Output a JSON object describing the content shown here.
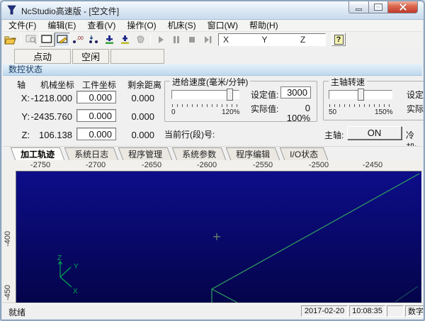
{
  "window": {
    "title": "NcStudio高速版 - [空文件]"
  },
  "menu": {
    "items": [
      "文件(F)",
      "编辑(E)",
      "查看(V)",
      "操作(O)",
      "机床(S)",
      "窗口(W)",
      "帮助(H)"
    ]
  },
  "toolbar": {
    "icons": [
      "open-file",
      "screen-capture",
      "display-window",
      "edit-window",
      "trace-points",
      "simulate-mode",
      "tool-down",
      "tool-calibrate",
      "handwheel",
      "start",
      "pause",
      "stop",
      "single-step",
      "help"
    ],
    "axes_display": "X              Y              Z",
    "help_label": "?"
  },
  "mode_row": {
    "jog": "点动",
    "idle": "空闲"
  },
  "nc_status": {
    "caption": "数控状态",
    "table": {
      "headers": [
        "轴",
        "机械坐标",
        "工件坐标",
        "剩余距离"
      ],
      "rows": [
        {
          "axis": "X:",
          "machine": "-1218.000",
          "work": "0.000",
          "remain": "0.000"
        },
        {
          "axis": "Y:",
          "machine": "-2435.760",
          "work": "0.000",
          "remain": "0.000"
        },
        {
          "axis": "Z:",
          "machine": "106.138",
          "work": "0.000",
          "remain": "0.000"
        }
      ]
    },
    "feed": {
      "title": "进给速度(毫米/分钟)",
      "tick_min": "0",
      "tick_max": "120%",
      "set_label": "设定值:",
      "set_value": "3000",
      "actual_label": "实际值:",
      "actual_value": "0",
      "override": "100%"
    },
    "current_line_label": "当前行(段)号:",
    "spindle": {
      "title": "主轴转速",
      "tick_min": "50",
      "tick_max": "150%",
      "set_label": "设定",
      "actual_label": "实际",
      "spindle_label": "主轴:",
      "power": "ON",
      "coolant_label": "冷却:"
    }
  },
  "view_tabs": [
    {
      "label": "加工轨迹"
    },
    {
      "label": "系统日志"
    },
    {
      "label": "程序管理"
    },
    {
      "label": "系统参数"
    },
    {
      "label": "程序编辑"
    },
    {
      "label": "I/O状态"
    }
  ],
  "canvas": {
    "h_ruler": [
      "-2750",
      "-2700",
      "-2650",
      "-2600",
      "-2550",
      "-2500",
      "-2450"
    ],
    "v_ruler": [
      "-400",
      "-450"
    ],
    "axes": {
      "x": "X",
      "y": "Y",
      "z": "Z"
    }
  },
  "statusbar": {
    "ready": "就绪",
    "date": "2017-02-20",
    "time": "10:08:35",
    "input_mode": "数字"
  },
  "colors": {
    "canvas_top": "#0d0d8a",
    "canvas_bottom": "#04044a",
    "trace_green": "#2fa25f",
    "caption_text": "#1b3d63"
  }
}
